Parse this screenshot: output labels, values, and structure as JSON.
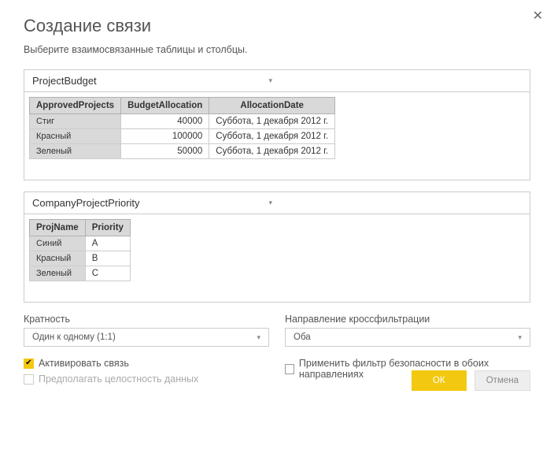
{
  "dialog": {
    "title": "Создание связи",
    "subtitle": "Выберите взаимосвязанные таблицы и столбцы."
  },
  "table1": {
    "selected": "ProjectBudget",
    "columns": [
      "ApprovedProjects",
      "BudgetAllocation",
      "AllocationDate"
    ],
    "rows": [
      {
        "c0": "Стиг",
        "c1": "40000",
        "c2": "Суббота, 1 декабря 2012 г."
      },
      {
        "c0": "Красный",
        "c1": "100000",
        "c2": "Суббота, 1 декабря 2012 г."
      },
      {
        "c0": "Зеленый",
        "c1": "50000",
        "c2": "Суббота, 1 декабря 2012 г."
      }
    ]
  },
  "table2": {
    "selected": "CompanyProjectPriority",
    "columns": [
      "ProjName",
      "Priority"
    ],
    "rows": [
      {
        "c0": "Синий",
        "c1": "A"
      },
      {
        "c0": "Красный",
        "c1": "B"
      },
      {
        "c0": "Зеленый",
        "c1": "C"
      }
    ]
  },
  "options": {
    "cardinality_label": "Кратность",
    "cardinality_value": "Один к одному (1:1)",
    "crossfilter_label": "Направление кроссфильтрации",
    "crossfilter_value": "Оба"
  },
  "checks": {
    "activate": "Активировать связь",
    "assume_integrity": "Предполагать целостность данных",
    "apply_security": "Применить фильтр безопасности в обоих направлениях"
  },
  "buttons": {
    "ok": "ОК",
    "cancel": "Отмена"
  }
}
